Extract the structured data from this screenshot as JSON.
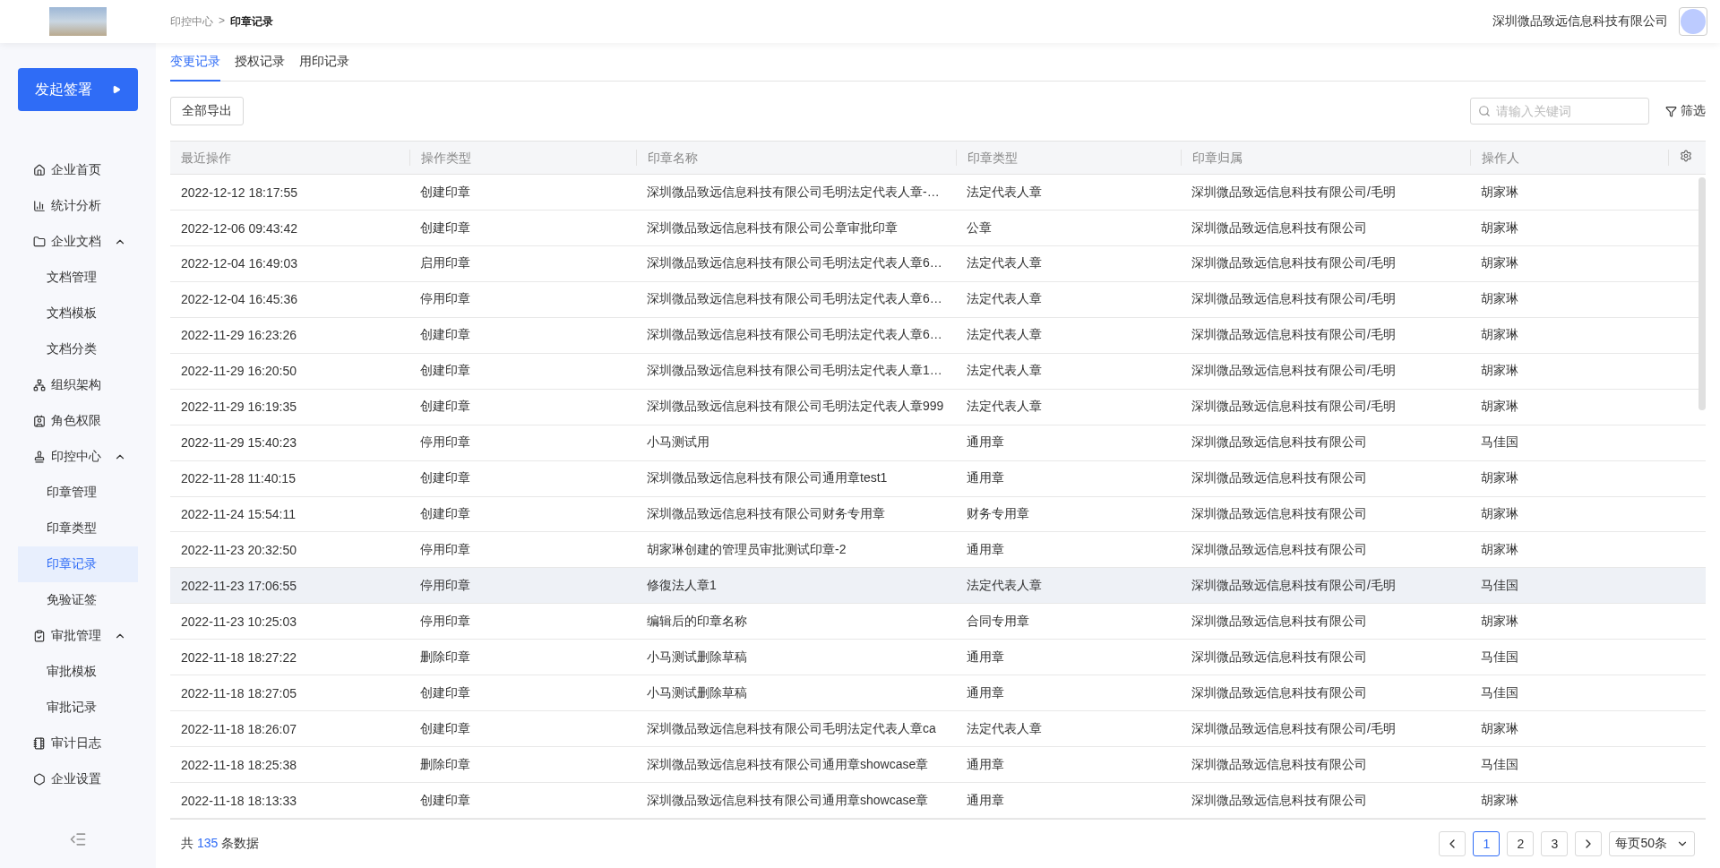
{
  "header": {
    "breadcrumb": [
      {
        "label": "印控中心",
        "current": false
      },
      {
        "label": "印章记录",
        "current": true
      }
    ],
    "separator": ">",
    "company": "深圳微品致远信息科技有限公司"
  },
  "sidebar": {
    "action": "发起签署",
    "items": [
      {
        "label": "企业首页",
        "selected": false
      },
      {
        "label": "统计分析",
        "selected": false
      },
      {
        "label": "企业文档",
        "selected": false,
        "expanded": true,
        "children": [
          {
            "label": "文档管理",
            "selected": false
          },
          {
            "label": "文档模板",
            "selected": false
          },
          {
            "label": "文档分类",
            "selected": false
          }
        ]
      },
      {
        "label": "组织架构",
        "selected": false
      },
      {
        "label": "角色权限",
        "selected": false
      },
      {
        "label": "印控中心",
        "selected": false,
        "expanded": true,
        "children": [
          {
            "label": "印章管理",
            "selected": false
          },
          {
            "label": "印章类型",
            "selected": false
          },
          {
            "label": "印章记录",
            "selected": true
          },
          {
            "label": "免验证签",
            "selected": false
          }
        ]
      },
      {
        "label": "审批管理",
        "selected": false,
        "expanded": true,
        "children": [
          {
            "label": "审批模板",
            "selected": false
          },
          {
            "label": "审批记录",
            "selected": false
          }
        ]
      },
      {
        "label": "审计日志",
        "selected": false
      },
      {
        "label": "企业设置",
        "selected": false
      }
    ]
  },
  "tabs": [
    {
      "label": "变更记录",
      "selected": true
    },
    {
      "label": "授权记录",
      "selected": false
    },
    {
      "label": "用印记录",
      "selected": false
    }
  ],
  "toolbar": {
    "export": "全部导出",
    "search": {
      "placeholder": "请输入关键词"
    },
    "filter": "筛选"
  },
  "table": {
    "columns": [
      "最近操作",
      "操作类型",
      "印章名称",
      "印章类型",
      "印章归属",
      "操作人"
    ],
    "rows": [
      {
        "cells": [
          "2022-12-12 18:17:55",
          "创建印章",
          "深圳微品致远信息科技有限公司毛明法定代表人章-…",
          "法定代表人章",
          "深圳微品致远信息科技有限公司/毛明",
          "胡家琳"
        ],
        "hovered": false
      },
      {
        "cells": [
          "2022-12-06 09:43:42",
          "创建印章",
          "深圳微品致远信息科技有限公司公章审批印章",
          "公章",
          "深圳微品致远信息科技有限公司",
          "胡家琳"
        ],
        "hovered": false
      },
      {
        "cells": [
          "2022-12-04 16:49:03",
          "启用印章",
          "深圳微品致远信息科技有限公司毛明法定代表人章6…",
          "法定代表人章",
          "深圳微品致远信息科技有限公司/毛明",
          "胡家琳"
        ],
        "hovered": false
      },
      {
        "cells": [
          "2022-12-04 16:45:36",
          "停用印章",
          "深圳微品致远信息科技有限公司毛明法定代表人章6…",
          "法定代表人章",
          "深圳微品致远信息科技有限公司/毛明",
          "胡家琳"
        ],
        "hovered": false
      },
      {
        "cells": [
          "2022-11-29 16:23:26",
          "创建印章",
          "深圳微品致远信息科技有限公司毛明法定代表人章6…",
          "法定代表人章",
          "深圳微品致远信息科技有限公司/毛明",
          "胡家琳"
        ],
        "hovered": false
      },
      {
        "cells": [
          "2022-11-29 16:20:50",
          "创建印章",
          "深圳微品致远信息科技有限公司毛明法定代表人章1…",
          "法定代表人章",
          "深圳微品致远信息科技有限公司/毛明",
          "胡家琳"
        ],
        "hovered": false
      },
      {
        "cells": [
          "2022-11-29 16:19:35",
          "创建印章",
          "深圳微品致远信息科技有限公司毛明法定代表人章999",
          "法定代表人章",
          "深圳微品致远信息科技有限公司/毛明",
          "胡家琳"
        ],
        "hovered": false
      },
      {
        "cells": [
          "2022-11-29 15:40:23",
          "停用印章",
          "小马测试用",
          "通用章",
          "深圳微品致远信息科技有限公司",
          "马佳国"
        ],
        "hovered": false
      },
      {
        "cells": [
          "2022-11-28 11:40:15",
          "创建印章",
          "深圳微品致远信息科技有限公司通用章test1",
          "通用章",
          "深圳微品致远信息科技有限公司",
          "胡家琳"
        ],
        "hovered": false
      },
      {
        "cells": [
          "2022-11-24 15:54:11",
          "创建印章",
          "深圳微品致远信息科技有限公司财务专用章",
          "财务专用章",
          "深圳微品致远信息科技有限公司",
          "胡家琳"
        ],
        "hovered": false
      },
      {
        "cells": [
          "2022-11-23 20:32:50",
          "停用印章",
          "胡家琳创建的管理员审批测试印章-2",
          "通用章",
          "深圳微品致远信息科技有限公司",
          "胡家琳"
        ],
        "hovered": false
      },
      {
        "cells": [
          "2022-11-23 17:06:55",
          "停用印章",
          "修復法人章1",
          "法定代表人章",
          "深圳微品致远信息科技有限公司/毛明",
          "马佳国"
        ],
        "hovered": true
      },
      {
        "cells": [
          "2022-11-23 10:25:03",
          "停用印章",
          "编辑后的印章名称",
          "合同专用章",
          "深圳微品致远信息科技有限公司",
          "胡家琳"
        ],
        "hovered": false
      },
      {
        "cells": [
          "2022-11-18 18:27:22",
          "删除印章",
          "小马测试删除草稿",
          "通用章",
          "深圳微品致远信息科技有限公司",
          "马佳国"
        ],
        "hovered": false
      },
      {
        "cells": [
          "2022-11-18 18:27:05",
          "创建印章",
          "小马测试删除草稿",
          "通用章",
          "深圳微品致远信息科技有限公司",
          "马佳国"
        ],
        "hovered": false
      },
      {
        "cells": [
          "2022-11-18 18:26:07",
          "创建印章",
          "深圳微品致远信息科技有限公司毛明法定代表人章ca",
          "法定代表人章",
          "深圳微品致远信息科技有限公司/毛明",
          "胡家琳"
        ],
        "hovered": false
      },
      {
        "cells": [
          "2022-11-18 18:25:38",
          "删除印章",
          "深圳微品致远信息科技有限公司通用章showcase章",
          "通用章",
          "深圳微品致远信息科技有限公司",
          "马佳国"
        ],
        "hovered": false
      },
      {
        "cells": [
          "2022-11-18 18:13:33",
          "创建印章",
          "深圳微品致远信息科技有限公司通用章showcase章",
          "通用章",
          "深圳微品致远信息科技有限公司",
          "胡家琳"
        ],
        "hovered": false
      }
    ]
  },
  "footer": {
    "total_prefix": "共",
    "total": "135",
    "total_suffix": "条数据",
    "pages": [
      {
        "label": "1",
        "selected": true
      },
      {
        "label": "2",
        "selected": false
      },
      {
        "label": "3",
        "selected": false
      }
    ],
    "page_size": "每页50条"
  }
}
